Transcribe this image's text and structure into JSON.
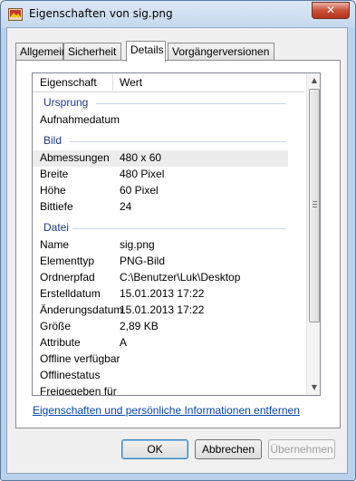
{
  "window": {
    "title": "Eigenschaften von sig.png",
    "close_label": "✕"
  },
  "tabs": [
    {
      "label": "Allgemein",
      "active": false
    },
    {
      "label": "Sicherheit",
      "active": false
    },
    {
      "label": "Details",
      "active": true
    },
    {
      "label": "Vorgängerversionen",
      "active": false
    }
  ],
  "list": {
    "headers": {
      "property": "Eigenschaft",
      "value": "Wert"
    },
    "groups": {
      "origin": "Ursprung",
      "image": "Bild",
      "file": "Datei"
    },
    "rows": [
      {
        "key": "Aufnahmedatum",
        "value": ""
      },
      {
        "key": "Abmessungen",
        "value": "480 x 60"
      },
      {
        "key": "Breite",
        "value": "480 Pixel"
      },
      {
        "key": "Höhe",
        "value": "60 Pixel"
      },
      {
        "key": "Bittiefe",
        "value": "24"
      },
      {
        "key": "Name",
        "value": "sig.png"
      },
      {
        "key": "Elementtyp",
        "value": "PNG-Bild"
      },
      {
        "key": "Ordnerpfad",
        "value": "C:\\Benutzer\\Luk\\Desktop"
      },
      {
        "key": "Erstelldatum",
        "value": "15.01.2013 17:22"
      },
      {
        "key": "Änderungsdatum",
        "value": "15.01.2013 17:22"
      },
      {
        "key": "Größe",
        "value": "2,89 KB"
      },
      {
        "key": "Attribute",
        "value": "A"
      },
      {
        "key": "Offline verfügbar",
        "value": ""
      },
      {
        "key": "Offlinestatus",
        "value": ""
      },
      {
        "key": "Freigegeben für",
        "value": ""
      }
    ]
  },
  "remove_link": "Eigenschaften und persönliche Informationen entfernen",
  "buttons": {
    "ok": "OK",
    "cancel": "Abbrechen",
    "apply": "Übernehmen"
  }
}
